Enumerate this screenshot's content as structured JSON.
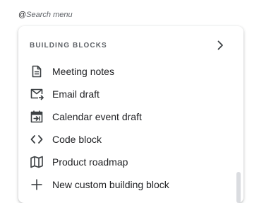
{
  "search": {
    "trigger": "@",
    "placeholder": "Search menu"
  },
  "menu": {
    "section_title": "BUILDING BLOCKS",
    "expand_icon": "chevron-right-icon",
    "items": [
      {
        "label": "Meeting notes",
        "icon": "document-icon"
      },
      {
        "label": "Email draft",
        "icon": "email-send-icon"
      },
      {
        "label": "Calendar event draft",
        "icon": "calendar-arrow-icon"
      },
      {
        "label": "Code block",
        "icon": "code-icon"
      },
      {
        "label": "Product roadmap",
        "icon": "map-icon"
      },
      {
        "label": "New custom building block",
        "icon": "plus-icon"
      }
    ]
  },
  "colors": {
    "text_primary": "#202124",
    "text_secondary": "#5f6368",
    "scrollbar": "#dadce0"
  }
}
